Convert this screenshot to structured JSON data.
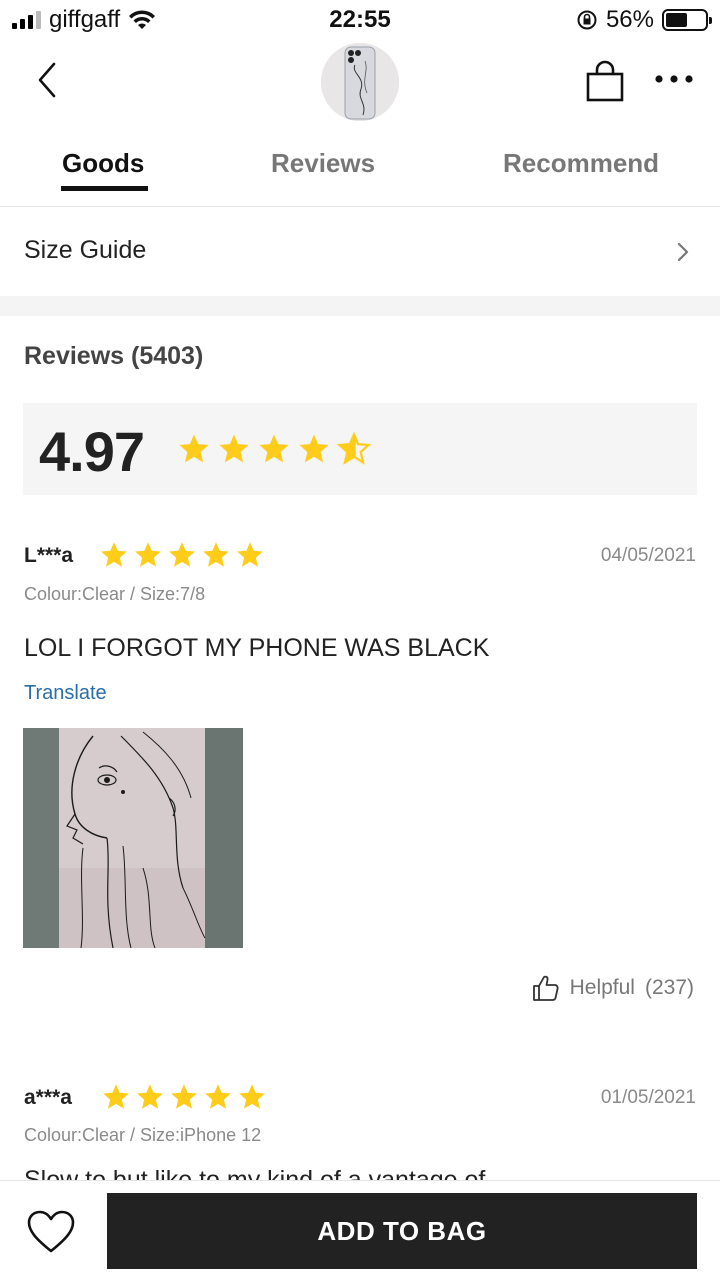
{
  "status_bar": {
    "carrier": "giffgaff",
    "time": "22:55",
    "battery_percent": "56%",
    "battery_level": 0.56,
    "icons": [
      "signal-icon",
      "wifi-icon",
      "orientation-lock-icon",
      "battery-icon"
    ]
  },
  "header": {
    "icons": [
      "back-icon",
      "product-thumbnail",
      "shopping-bag-icon",
      "more-icon"
    ]
  },
  "tabs": [
    {
      "label": "Goods",
      "active": true
    },
    {
      "label": "Reviews",
      "active": false
    },
    {
      "label": "Recommend",
      "active": false
    }
  ],
  "size_guide": {
    "label": "Size Guide"
  },
  "reviews": {
    "title": "Reviews (5403)",
    "average_rating": "4.97",
    "average_stars": 4.97,
    "items": [
      {
        "user": "L***a",
        "stars": 5,
        "date": "04/05/2021",
        "meta": "Colour:Clear / Size:7/8",
        "text": "LOL I FORGOT MY PHONE WAS BLACK",
        "translate": "Translate",
        "helpful_label": "Helpful",
        "helpful_count": "(237)"
      },
      {
        "user": "a***a",
        "stars": 5,
        "date": "01/05/2021",
        "meta": "Colour:Clear / Size:iPhone 12",
        "text_partial": "Slow to but like to my kind of a vantage of"
      }
    ]
  },
  "bottom_bar": {
    "add_to_bag": "ADD TO BAG"
  },
  "colors": {
    "star": "#FFCC1A",
    "link": "#2A6EA8",
    "button_bg": "#222222"
  }
}
